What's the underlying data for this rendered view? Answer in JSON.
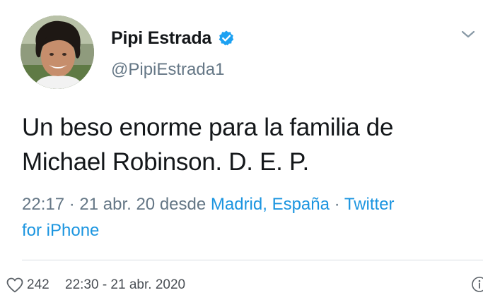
{
  "tweet": {
    "display_name": "Pipi Estrada",
    "handle": "@PipiEstrada1",
    "text_line1": "Un beso enorme para la familia de",
    "text_line2": "Michael Robinson. D. E. P.",
    "time": "22:17 · 21 abr. 20 desde ",
    "location": "Madrid, España",
    "separator": " · ",
    "source_part1": "Twitter",
    "source_part2": "for iPhone"
  },
  "footer": {
    "likes": "242",
    "timestamp": "22:30 - 21 abr. 2020"
  },
  "colors": {
    "text_primary": "#14171a",
    "text_secondary": "#657786",
    "link": "#1b95e0",
    "verified": "#1da1f2"
  },
  "icons": {
    "verified": "verified-badge-icon",
    "caret": "chevron-down-icon",
    "heart": "heart-icon",
    "info": "info-icon"
  }
}
